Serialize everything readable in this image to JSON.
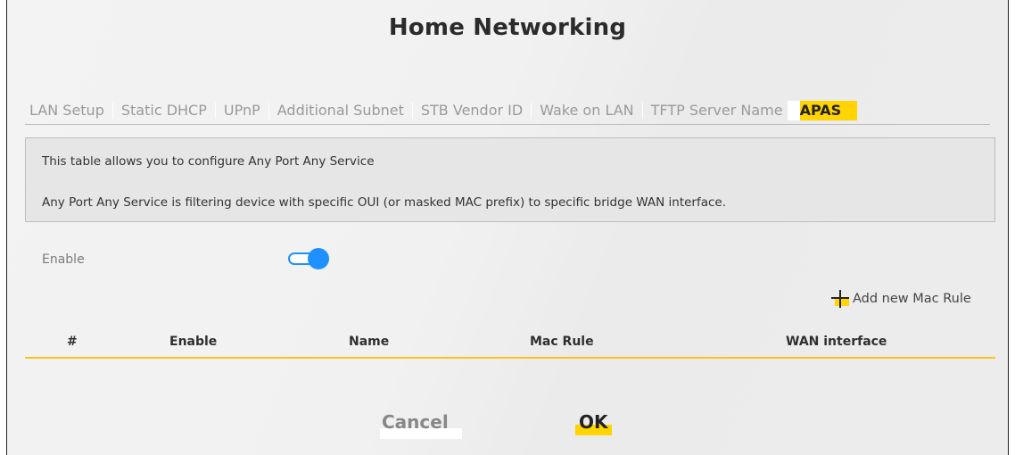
{
  "page": {
    "title": "Home Networking"
  },
  "tabs": [
    {
      "label": "LAN Setup",
      "active": false
    },
    {
      "label": "Static DHCP",
      "active": false
    },
    {
      "label": "UPnP",
      "active": false
    },
    {
      "label": "Additional Subnet",
      "active": false
    },
    {
      "label": "STB Vendor ID",
      "active": false
    },
    {
      "label": "Wake on LAN",
      "active": false
    },
    {
      "label": "TFTP Server Name",
      "active": false
    },
    {
      "label": "APAS",
      "active": true
    }
  ],
  "info": {
    "line1": "This table allows you to configure Any Port Any Service",
    "line2": "Any Port Any Service is filtering device with specific OUI (or masked MAC prefix) to specific bridge WAN interface."
  },
  "enable": {
    "label": "Enable",
    "on": true
  },
  "add_rule": {
    "label": "Add new Mac Rule",
    "icon": "plus-icon"
  },
  "table": {
    "columns": [
      "#",
      "Enable",
      "Name",
      "Mac Rule",
      "WAN interface"
    ],
    "rows": []
  },
  "actions": {
    "cancel_label": "Cancel",
    "ok_label": "OK"
  },
  "colors": {
    "accent_yellow": "#ffd400",
    "toggle_blue": "#1e90ff",
    "header_rule": "#ffc21a"
  }
}
